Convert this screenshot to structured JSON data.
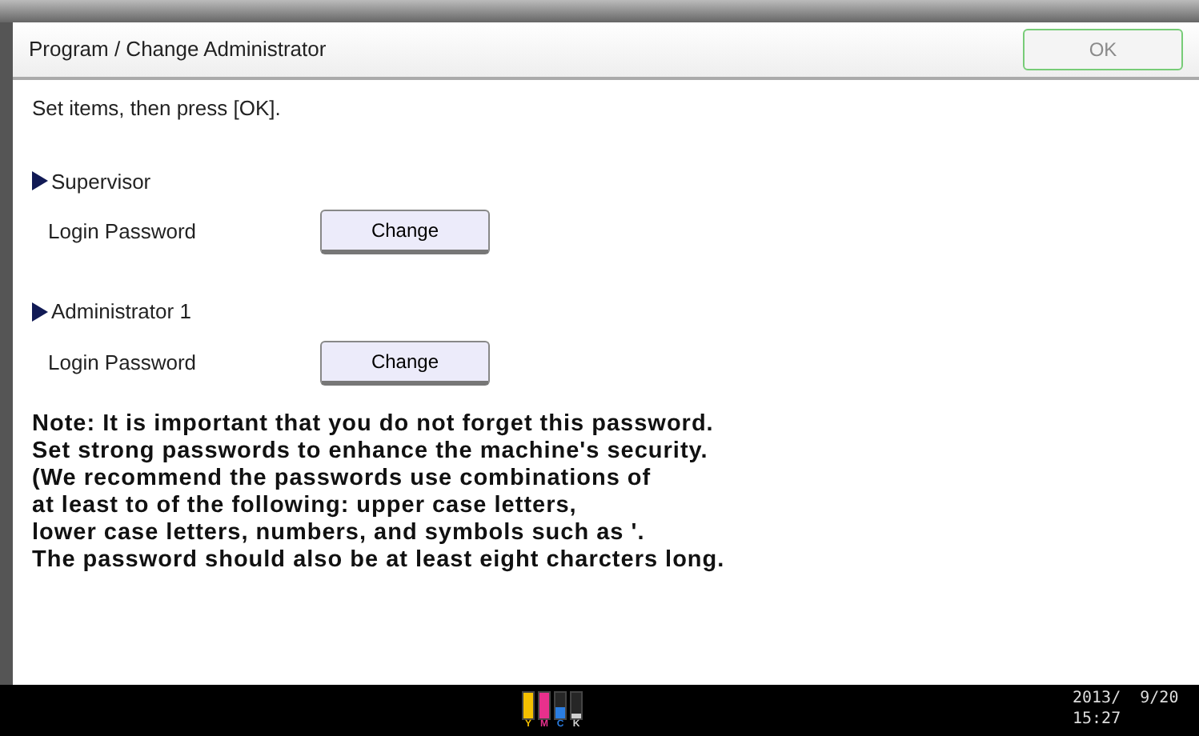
{
  "window": {
    "title": "Program / Change Administrator"
  },
  "ok_button": {
    "label": "OK",
    "disabled": true
  },
  "instruction": "Set items, then press [OK].",
  "sections": [
    {
      "heading": "Supervisor",
      "field_label": "Login Password",
      "button": "Change"
    },
    {
      "heading": "Administrator 1",
      "field_label": "Login Password",
      "button": "Change"
    }
  ],
  "note_lines": [
    "Note: It is important that you do not forget this password.",
    "Set strong passwords to enhance the machine's security.",
    "(We recommend the passwords use combinations of",
    "at least to of the following:  upper case letters,",
    "lower case letters, numbers, and symbols such as '.",
    "The password should also be at least eight charcters long."
  ],
  "status_bar": {
    "toner": [
      {
        "label": "Y",
        "color": "#f5c000",
        "level": 1
      },
      {
        "label": "M",
        "color": "#e8308c",
        "level": 1
      },
      {
        "label": "C",
        "color": "#2a7de1",
        "level": 0.45
      },
      {
        "label": "K",
        "color": "#d0d0d0",
        "level": 0.2
      }
    ],
    "date": "2013/  9/20",
    "time": "15:27"
  }
}
